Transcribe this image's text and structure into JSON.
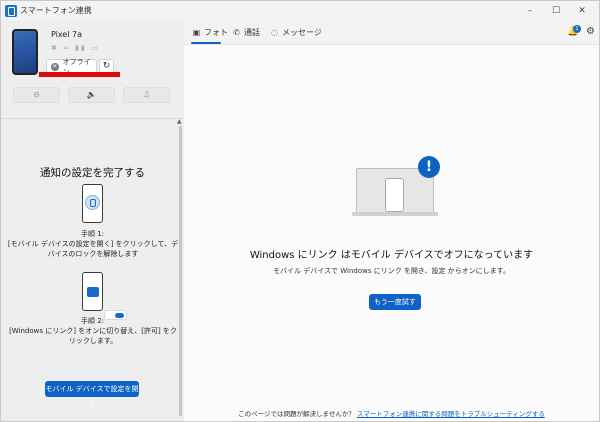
{
  "app": {
    "title": "スマートフォン連携"
  },
  "window_controls": {
    "minimize": "–",
    "maximize": "☐",
    "close": "✕"
  },
  "device": {
    "name": "Pixel 7a",
    "indicators": "✱ ≈ ▮▮ ▭",
    "status": "オフライン",
    "status_icon": "✕",
    "refresh_icon": "↻"
  },
  "quick_actions": [
    {
      "name": "do-not-disturb-icon",
      "glyph": "⊖"
    },
    {
      "name": "volume-icon",
      "glyph": "🔈"
    },
    {
      "name": "music-icon",
      "glyph": "♫"
    }
  ],
  "notify": {
    "title": "通知の設定を完了する",
    "step1_label": "手順 1:",
    "step1_desc": "[モバイル デバイスの設定を開く] をクリックして、デバイスのロックを解除します",
    "step2_label": "手順 2:",
    "step2_desc": "[Windows にリンク] をオンに切り替え、[許可] をクリックします。",
    "open_settings_button": "モバイル デバイスで設定を開く"
  },
  "tabs": [
    {
      "label": "フォト",
      "icon": "▣"
    },
    {
      "label": "通話",
      "icon": "✆"
    },
    {
      "label": "メッセージ",
      "icon": "◌"
    }
  ],
  "header": {
    "notification_count": "1",
    "bell_icon": "🔔",
    "settings_icon": "⚙"
  },
  "main": {
    "alert_glyph": "!",
    "heading": "Windows にリンク はモバイル デバイスでオフになっています",
    "subtext": "モバイル デバイスで Windows にリンク を開き、設定 からオンにします。",
    "retry_button": "もう一度試す",
    "footer_text": "このページでは問題が解決しませんか？",
    "footer_link": "スマートフォン連携に関する問題をトラブルシューティングする"
  }
}
